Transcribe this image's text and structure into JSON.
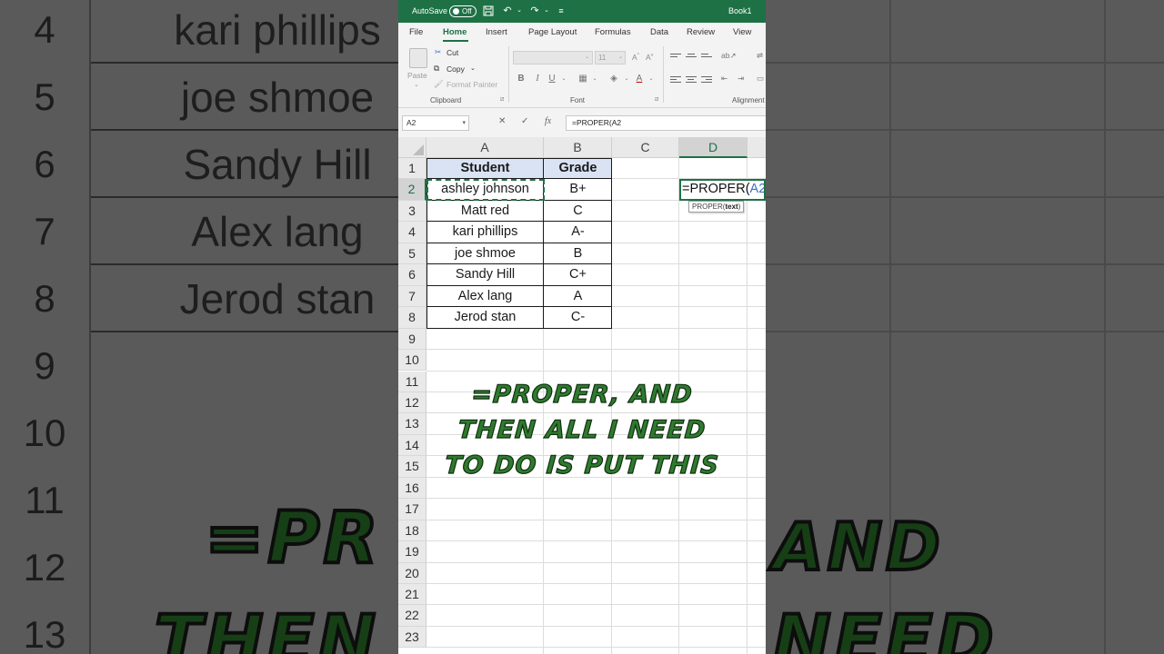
{
  "background": {
    "rows": [
      {
        "num": "4",
        "text": "kari phillips"
      },
      {
        "num": "5",
        "text": "joe shmoe"
      },
      {
        "num": "6",
        "text": "Sandy Hill"
      },
      {
        "num": "7",
        "text": "Alex lang"
      },
      {
        "num": "8",
        "text": "Jerod stan"
      },
      {
        "num": "9",
        "text": ""
      },
      {
        "num": "10",
        "text": ""
      },
      {
        "num": "11",
        "text": ""
      },
      {
        "num": "12",
        "text": ""
      },
      {
        "num": "13",
        "text": ""
      }
    ],
    "big_caption_line1_left": "=PR",
    "big_caption_line1_right": "AND",
    "big_caption_line2_left": "THEN",
    "big_caption_line2_right": "NEED"
  },
  "titlebar": {
    "autosave_label": "AutoSave",
    "autosave_state": "Off",
    "book_title": "Book1",
    "color": "#1e7145"
  },
  "ribbon": {
    "tabs": [
      "File",
      "Home",
      "Insert",
      "Page Layout",
      "Formulas",
      "Data",
      "Review",
      "View"
    ],
    "active_tab": "Home",
    "clipboard": {
      "paste": "Paste",
      "cut": "Cut",
      "copy": "Copy",
      "format_painter": "Format Painter",
      "group_label": "Clipboard"
    },
    "font": {
      "size": "11",
      "group_label": "Font"
    },
    "alignment": {
      "group_label": "Alignment"
    }
  },
  "formula_bar": {
    "name_box": "A2",
    "formula": "=PROPER(A2"
  },
  "sheet": {
    "columns": [
      "A",
      "B",
      "C",
      "D"
    ],
    "selected_column": "D",
    "row_numbers": [
      "1",
      "2",
      "3",
      "4",
      "5",
      "6",
      "7",
      "8",
      "9",
      "10",
      "11",
      "12",
      "13",
      "14",
      "15",
      "16",
      "17",
      "18",
      "19",
      "20",
      "21",
      "22",
      "23"
    ],
    "selected_row": "2",
    "header": {
      "student": "Student",
      "grade": "Grade"
    },
    "students": [
      {
        "name": "ashley johnson",
        "grade": "B+"
      },
      {
        "name": "Matt red",
        "grade": "C"
      },
      {
        "name": "kari phillips",
        "grade": "A-"
      },
      {
        "name": "joe shmoe",
        "grade": "B"
      },
      {
        "name": "Sandy Hill",
        "grade": "C+"
      },
      {
        "name": "Alex lang",
        "grade": "A"
      },
      {
        "name": "Jerod stan",
        "grade": "C-"
      }
    ],
    "editing_cell": {
      "prefix": "=PROPER(",
      "ref": "A2"
    },
    "tooltip": {
      "func": "PROPER(",
      "arg": "text",
      "close": ")"
    }
  },
  "caption": {
    "line1": "=PROPER, AND",
    "line2": "THEN ALL I NEED",
    "line3": "TO DO IS PUT THIS"
  }
}
